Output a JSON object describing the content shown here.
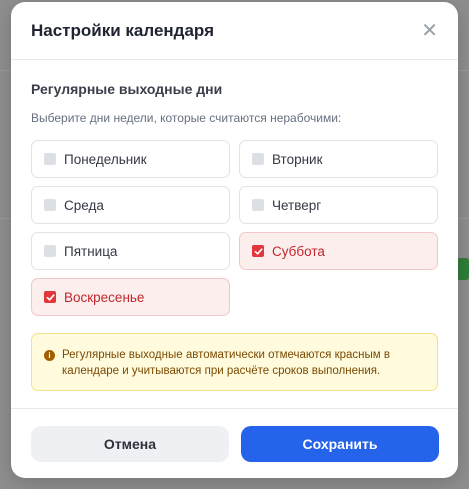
{
  "modal": {
    "title": "Настройки календаря",
    "close_icon": "close-icon"
  },
  "section": {
    "title": "Регулярные выходные дни",
    "hint": "Выберите дни недели, которые считаются нерабочими:"
  },
  "days": [
    {
      "label": "Понедельник",
      "checked": false
    },
    {
      "label": "Вторник",
      "checked": false
    },
    {
      "label": "Среда",
      "checked": false
    },
    {
      "label": "Четверг",
      "checked": false
    },
    {
      "label": "Пятница",
      "checked": false
    },
    {
      "label": "Суббота",
      "checked": true
    },
    {
      "label": "Воскресенье",
      "checked": true
    }
  ],
  "notice": {
    "icon": "info-icon",
    "text": "Регулярные выходные автоматически отмечаются красным в календаре и учитываются при расчёте сроков выполнения."
  },
  "footer": {
    "cancel_label": "Отмена",
    "save_label": "Сохранить"
  },
  "colors": {
    "accent": "#2563eb",
    "weekend": "#e0363c",
    "notice_bg": "#fffbdc"
  }
}
